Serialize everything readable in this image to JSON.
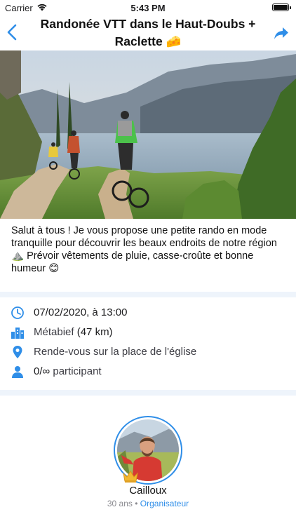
{
  "status_bar": {
    "carrier": "Carrier",
    "time": "5:43 PM"
  },
  "nav": {
    "title_line1": "Randonée VTT dans le Haut-Doubs +",
    "title_line2": "Raclette 🧀"
  },
  "description": "Salut à tous ! Je vous propose une petite rando en mode tranquille pour découvrir les beaux endroits de notre région ⛰️ Prévoir vêtements de pluie, casse-croûte et bonne humeur 😊",
  "details": {
    "date": "07/02/2020, à 13:00",
    "location_town": "Métabief",
    "location_distance": "(47 km)",
    "meeting_point": "Rende-vous sur la place de l'église",
    "participants_count": "0/∞",
    "participants_label": "participant"
  },
  "organizer": {
    "name": "Cailloux",
    "age": "30 ans",
    "separator": "•",
    "role": "Organisateur"
  },
  "colors": {
    "accent": "#2f8ee8",
    "divider": "#eef4fb"
  }
}
